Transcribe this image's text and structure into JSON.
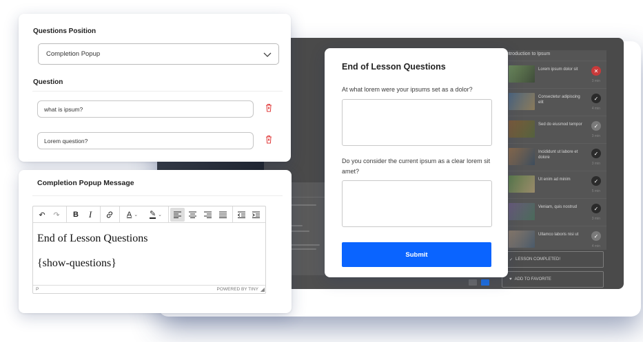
{
  "question_settings": {
    "position_label": "Questions Position",
    "position_value": "Completion Popup",
    "question_label": "Question",
    "questions": [
      {
        "value": "what is ipsum?"
      },
      {
        "value": "Lorem question?"
      }
    ]
  },
  "completion_message": {
    "label": "Completion Popup Message",
    "editor_line1": "End of Lesson Questions",
    "editor_line2": "{show-questions}",
    "status_path": "P",
    "powered_by": "POWERED BY TINY"
  },
  "popup": {
    "title": "End of Lesson Questions",
    "question1": "At what lorem were your ipsums set as a dolor?",
    "question2": "Do you consider the current ipsum as a clear lorem sit amet?",
    "submit_label": "Submit"
  },
  "background_app": {
    "sidebar_title": "Introduction to Ipsum",
    "lessons": [
      {
        "title": "Lorem ipsum dolor sit",
        "status": "wrong",
        "duration": "3 min"
      },
      {
        "title": "Consectetur adipiscing elit",
        "status": "done",
        "duration": "4 min"
      },
      {
        "title": "Sed do eiusmod tempor",
        "status": "pending",
        "duration": "3 min"
      },
      {
        "title": "Incididunt ut labore et dolore",
        "status": "done",
        "duration": "3 min"
      },
      {
        "title": "Ut enim ad minim",
        "status": "done",
        "duration": "5 min"
      },
      {
        "title": "Veniam, quis nostrud",
        "status": "done",
        "duration": "3 min"
      },
      {
        "title": "Ullamco laboris nisi ut",
        "status": "pending",
        "duration": "4 min"
      }
    ],
    "completed_button": "LESSON COMPLETED!",
    "favorite_button": "ADD TO FAVORITE"
  },
  "colors": {
    "accent": "#0a64ff",
    "danger": "#e03a3a",
    "background_app": "#4a4a4a"
  }
}
